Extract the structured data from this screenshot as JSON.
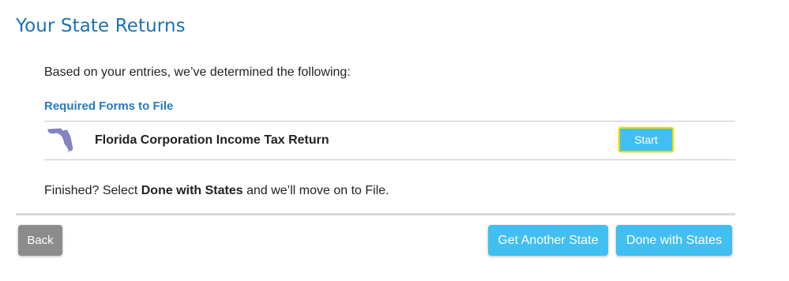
{
  "header": {
    "title": "Your State Returns"
  },
  "main": {
    "intro": "Based on your entries, we’ve determined the following:",
    "required_heading": "Required Forms to File",
    "forms": [
      {
        "state_icon": "florida-state-icon",
        "name": "Florida Corporation Income Tax Return",
        "action_label": "Start"
      }
    ],
    "finished": {
      "prefix": "Finished? Select ",
      "bold": "Done with States",
      "suffix": " and we’ll move on to File."
    }
  },
  "footer": {
    "back_label": "Back",
    "get_another_label": "Get Another State",
    "done_label": "Done with States"
  },
  "colors": {
    "title": "#1a73b5",
    "heading": "#2679c2",
    "primary_button": "#41bff0",
    "back_button": "#8c8c8c",
    "focus_outline": "#ecd900"
  }
}
